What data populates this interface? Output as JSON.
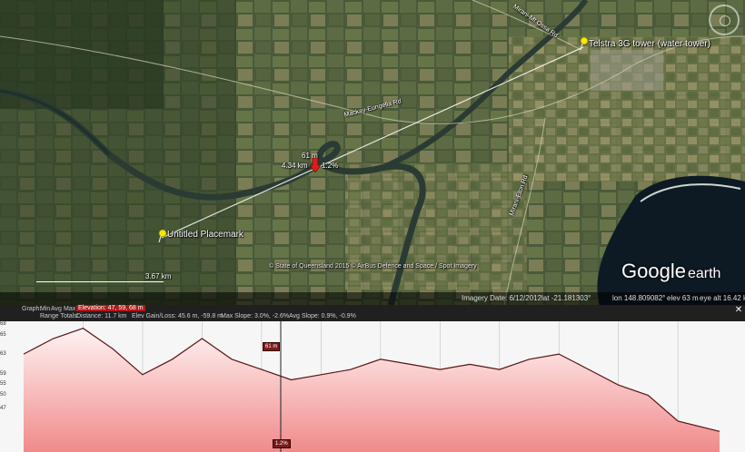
{
  "map": {
    "road_labels": [
      "Mackay-Eungella Rd",
      "Mirani-Mt Ossa Rd",
      "Mirani-Eton Rd"
    ],
    "placemarks": [
      {
        "name": "Telstra 3G tower (water tower)",
        "icon": "yellow-pushpin-icon"
      },
      {
        "name": "Untitled Placemark",
        "icon": "yellow-pushpin-icon"
      }
    ],
    "path_cursor": {
      "elevation": "61 m",
      "distance": "4.34 km",
      "slope": "1.2%"
    },
    "scale_label": "3.67 km",
    "attribution": "© State of Queensland 2015 © AirBus Defence and Space / Spot Imagery",
    "logo": {
      "google": "Google",
      "earth": "earth"
    },
    "nav_icon": "compass-icon"
  },
  "status_bar": {
    "imagery_date": "Imagery Date: 6/12/2012",
    "lat": "lat   -21.181303°",
    "lon": "lon  148.809082°",
    "elev": "elev    63 m",
    "eye_alt": "eye alt  16.42 km"
  },
  "elevation_profile": {
    "toolbar_row1": {
      "graph": "Graph:",
      "min": "Min",
      "avg": "Avg",
      "max": "Max",
      "elevation": "Elevation: 47, 59, 68 m"
    },
    "toolbar_row2": {
      "range_totals": "Range Totals:",
      "distance": "Distance: 11.7 km",
      "gain_loss": "Elev Gain/Loss: 45.6 m, -59.8 m",
      "max_slope": "Max Slope: 3.0%, -2.6%",
      "avg_slope": "Avg Slope: 0.9%, -0.9%"
    },
    "y_tick_labels": [
      "68",
      "65",
      "63",
      "59",
      "55",
      "50",
      "47"
    ],
    "cursor_elevation_label": "61 m",
    "cursor_slope_label": "1.2%",
    "colors": {
      "fill_top": "#fff3f3",
      "fill_bottom": "#f08a8a",
      "line": "#5a1414",
      "accent": "#b01818"
    },
    "chart_data": {
      "type": "area",
      "x": [
        0,
        0.5,
        1,
        1.5,
        2,
        2.5,
        3,
        3.5,
        4,
        4.5,
        5,
        5.5,
        6,
        6.5,
        7,
        7.5,
        8,
        8.5,
        9,
        9.5,
        10,
        10.5,
        11,
        11.7
      ],
      "values": [
        63,
        66,
        68,
        64,
        59,
        62,
        66,
        62,
        60,
        58,
        59,
        60,
        62,
        61,
        60,
        61,
        60,
        62,
        63,
        60,
        57,
        55,
        50,
        48
      ]
    }
  }
}
